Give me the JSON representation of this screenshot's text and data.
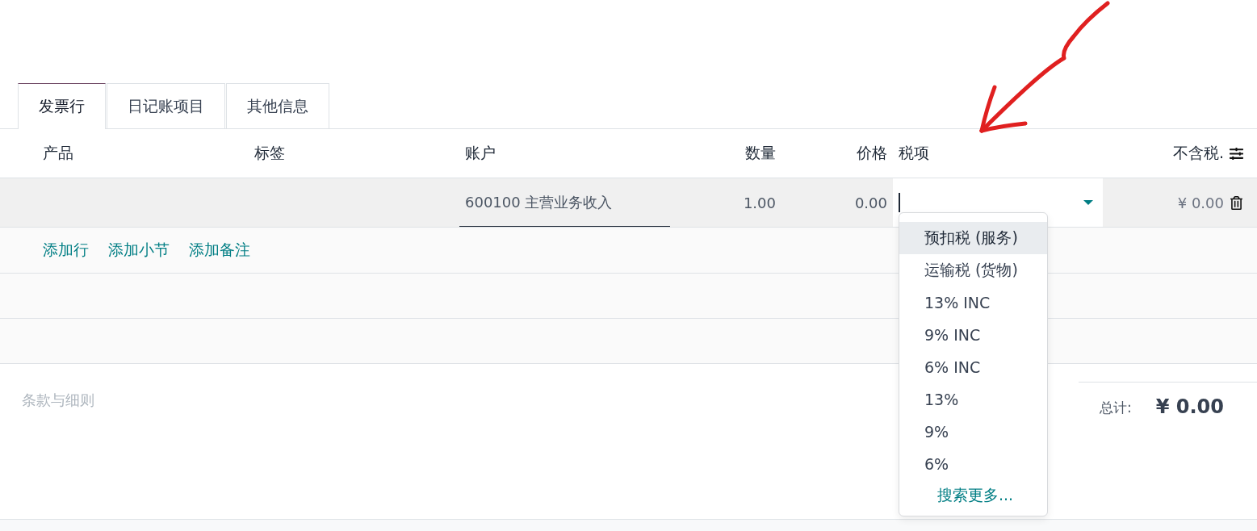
{
  "tabs": [
    {
      "label": "发票行",
      "selected": true
    },
    {
      "label": "日记账项目",
      "selected": false
    },
    {
      "label": "其他信息",
      "selected": false
    }
  ],
  "columns": [
    {
      "label": "产品",
      "kind": "text"
    },
    {
      "label": "标签",
      "kind": "text"
    },
    {
      "label": "账户",
      "kind": "text"
    },
    {
      "label": "数量",
      "kind": "number"
    },
    {
      "label": "价格",
      "kind": "number"
    },
    {
      "label": "税项",
      "kind": "text"
    },
    {
      "label": "不含税.",
      "kind": "number"
    }
  ],
  "rows": [
    {
      "account": "600100 主营业务收入",
      "quantity": "1.00",
      "price": "0.00",
      "subtotal": "¥ 0.00"
    }
  ],
  "add_links": [
    "添加行",
    "添加小节",
    "添加备注"
  ],
  "tax_dropdown": {
    "open": true,
    "options": [
      {
        "label": "预扣税 (服务)",
        "selected": true
      },
      {
        "label": "运输税 (货物)",
        "selected": false
      },
      {
        "label": "13% INC",
        "selected": false
      },
      {
        "label": "9% INC",
        "selected": false
      },
      {
        "label": "6% INC",
        "selected": false
      },
      {
        "label": "13%",
        "selected": false
      },
      {
        "label": "9%",
        "selected": false
      },
      {
        "label": "6%",
        "selected": false
      }
    ],
    "search_more": "搜索更多..."
  },
  "terms_placeholder": "条款与细则",
  "total": {
    "label": "总计:",
    "value": "¥ 0.00"
  }
}
